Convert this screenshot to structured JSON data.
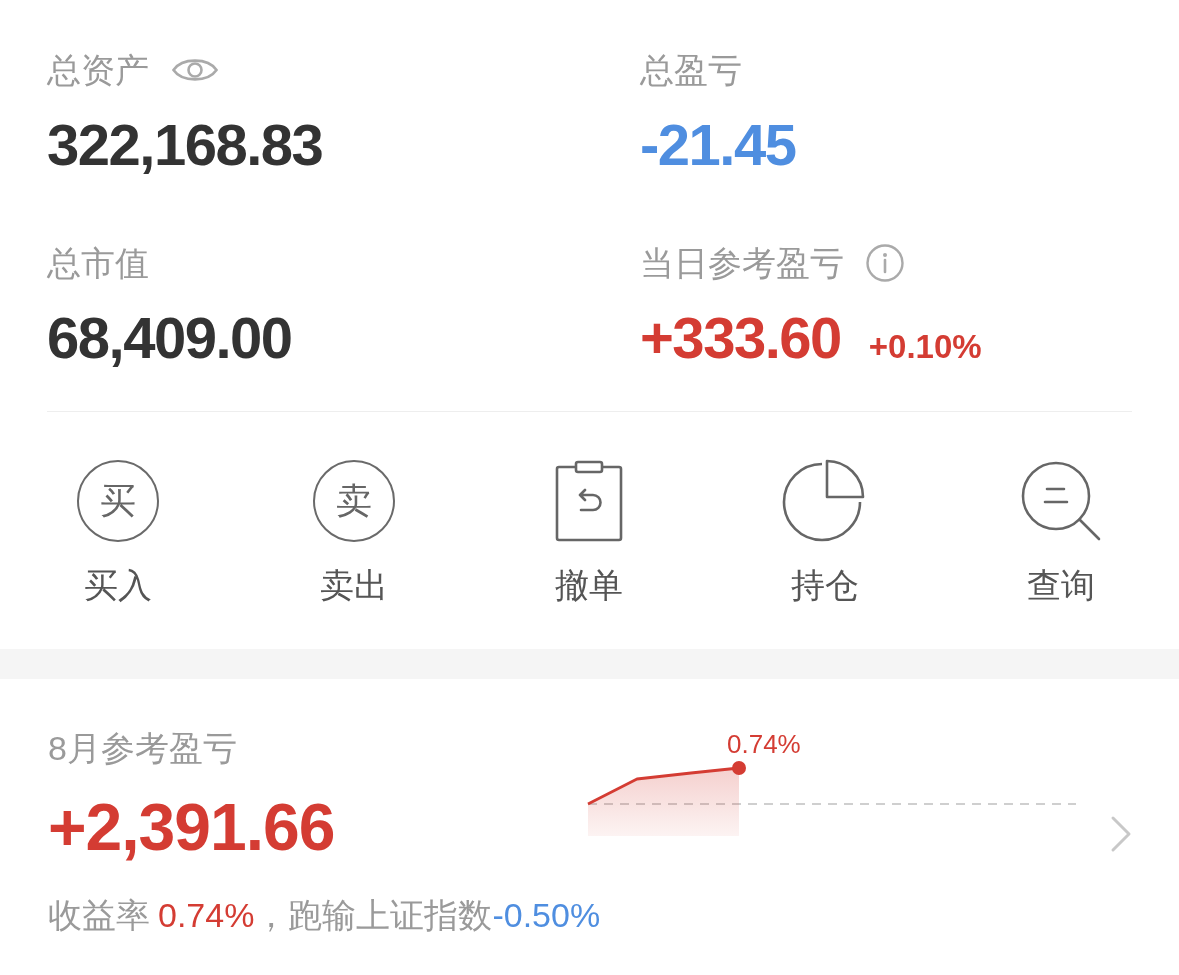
{
  "overview": {
    "stats": [
      {
        "label": "总资产",
        "value": "322,168.83",
        "color": "#333333"
      },
      {
        "label": "总盈亏",
        "value": "-21.45",
        "color": "#4f8ee0"
      },
      {
        "label": "总市值",
        "value": "68,409.00",
        "color": "#333333"
      },
      {
        "label": "当日参考盈亏",
        "value": "+333.60",
        "change": "+0.10%",
        "color": "#d43c33"
      }
    ]
  },
  "actions": [
    {
      "label": "买入",
      "kind": "circled-character",
      "glyph": "买"
    },
    {
      "label": "卖出",
      "kind": "circled-character",
      "glyph": "卖"
    },
    {
      "label": "撤单",
      "kind": "clipboard"
    },
    {
      "label": "持仓",
      "kind": "pie-chart"
    },
    {
      "label": "查询",
      "kind": "search"
    }
  ],
  "monthly": {
    "title": "8月参考盈亏",
    "value": "+2,391.66",
    "color": "#d43c33",
    "sparkline": {
      "end_label": "0.74%"
    },
    "summary": [
      {
        "text": "收益率",
        "color": "#9a9a9a"
      },
      {
        "text": "0.74%",
        "color": "#d43c33"
      },
      {
        "text": "，跑输上证指数",
        "color": "#9a9a9a"
      },
      {
        "text": "-0.50%",
        "color": "#4f8ee0"
      }
    ]
  }
}
